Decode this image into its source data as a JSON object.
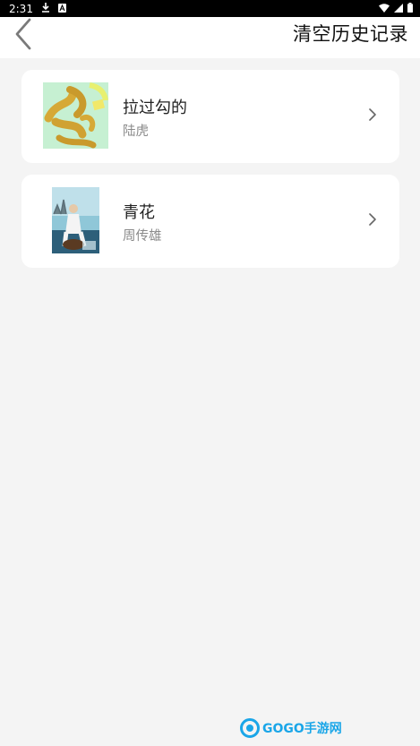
{
  "status": {
    "time": "2:31"
  },
  "header": {
    "clear_history_label": "清空历史记录"
  },
  "history": [
    {
      "title": "拉过勾的",
      "artist": "陆虎"
    },
    {
      "title": "青花",
      "artist": "周传雄"
    }
  ],
  "watermark": {
    "text": "GOGO手游网"
  },
  "colors": {
    "background": "#f4f4f4",
    "card": "#ffffff",
    "watermark": "#1aa6e8"
  }
}
